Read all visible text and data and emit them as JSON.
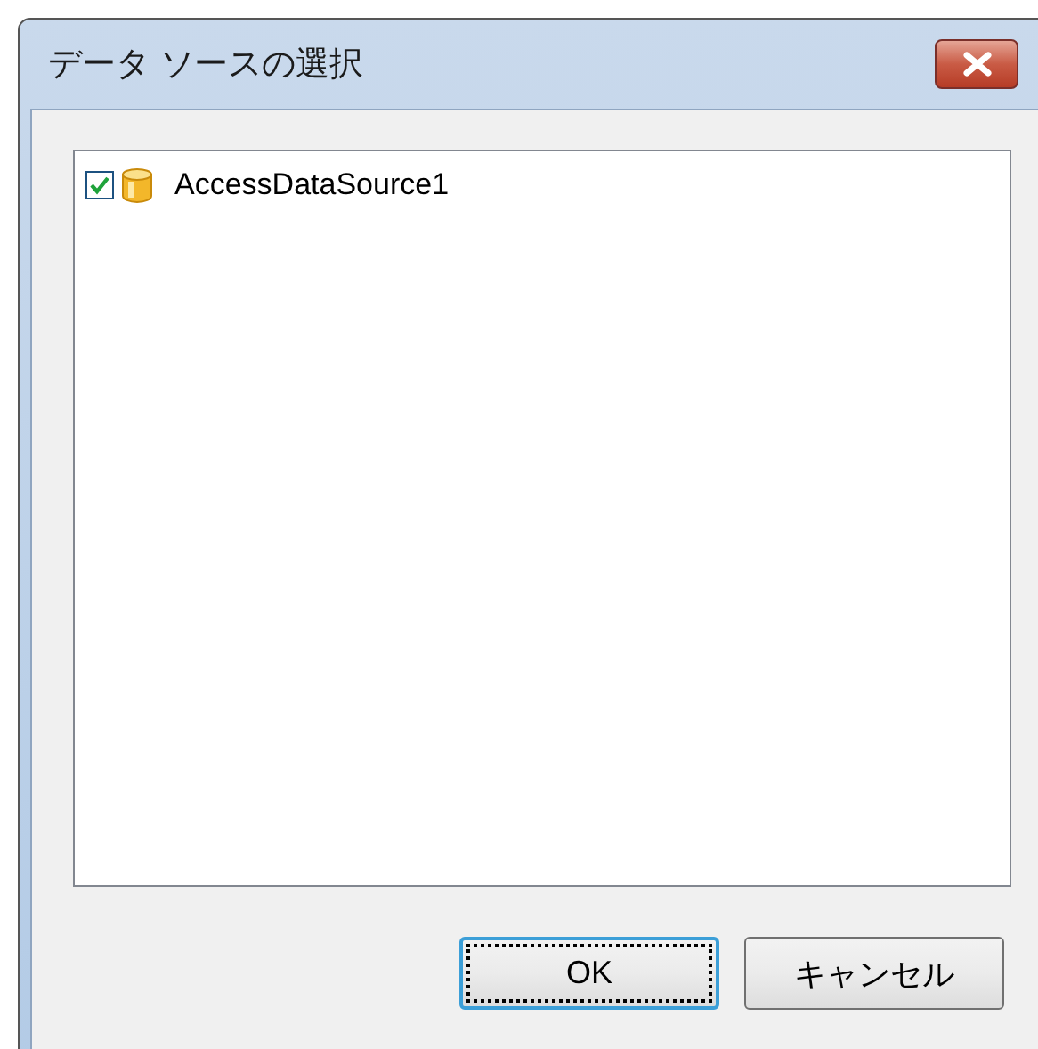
{
  "window": {
    "title": "データ ソースの選択"
  },
  "list": {
    "items": [
      {
        "label": "AccessDataSource1",
        "checked": true
      }
    ]
  },
  "buttons": [
    {
      "label": "OK",
      "focused": true
    },
    {
      "label": "キャンセル",
      "focused": false
    }
  ]
}
